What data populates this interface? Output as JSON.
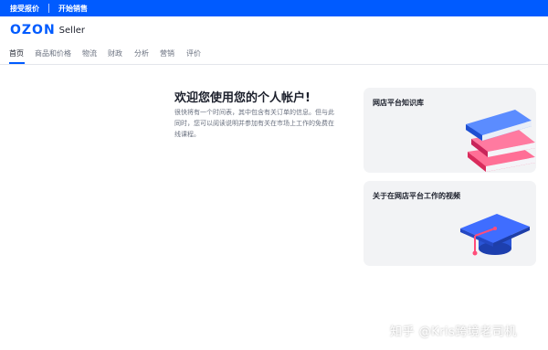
{
  "topbar": {
    "link1": "接受报价",
    "link2": "开始销售"
  },
  "header": {
    "logo_brand": "OZON",
    "logo_product": "Seller"
  },
  "nav": {
    "tabs": [
      {
        "label": "首页",
        "active": true
      },
      {
        "label": "商品和价格",
        "active": false
      },
      {
        "label": "物流",
        "active": false
      },
      {
        "label": "财政",
        "active": false
      },
      {
        "label": "分析",
        "active": false
      },
      {
        "label": "营销",
        "active": false
      },
      {
        "label": "评价",
        "active": false
      }
    ]
  },
  "main": {
    "title": "欢迎您使用您的个人帐户!",
    "description": "很快将有一个时间表，其中包含有关订单的信息。但与此同时，您可以阅读说明并参加有关在市场上工作的免费在线课程。"
  },
  "cards": [
    {
      "title": "网店平台知识库",
      "icon": "books-icon"
    },
    {
      "title": "关于在网店平台工作的视频",
      "icon": "graduation-cap-icon"
    }
  ],
  "watermark": "知乎 @Kris跨境老司机",
  "colors": {
    "brand_blue": "#005bff",
    "card_bg": "#f2f3f5",
    "book_blue": "#2f6bf2",
    "book_pink": "#ff3c6e"
  }
}
